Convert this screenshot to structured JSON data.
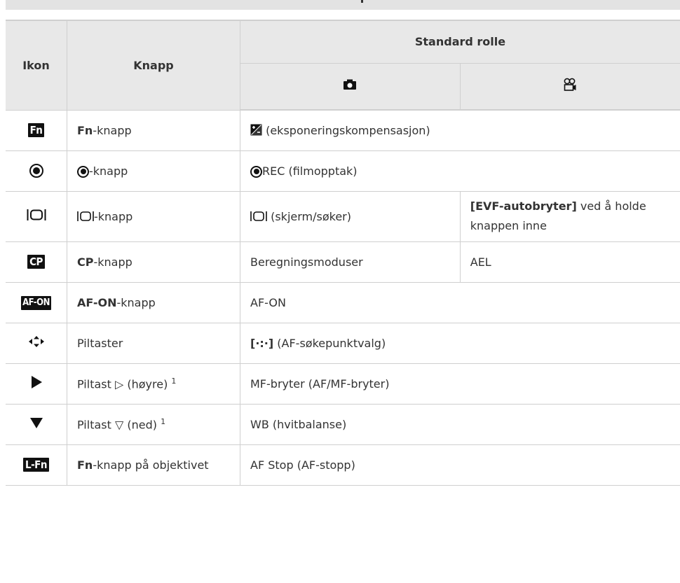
{
  "header": {
    "ikon": "Ikon",
    "knapp": "Knapp",
    "standard_rolle": "Standard rolle",
    "photo_icon": "camera-icon",
    "video_icon": "movie-camera-icon"
  },
  "rows": [
    {
      "icon": "Fn",
      "knapp_bold": "Fn",
      "knapp_rest": "-knapp",
      "photo": "(eksponeringskompensasjon)",
      "video": ""
    },
    {
      "icon": "record-icon",
      "knapp_bold": "",
      "knapp_rest": "-knapp",
      "photo": "REC (filmopptak)",
      "video": ""
    },
    {
      "icon": "monitor-viewer-icon",
      "knapp_bold": "",
      "knapp_rest": "-knapp",
      "photo": "(skjerm/søker)",
      "video_bold": "[EVF-autobryter]",
      "video": "ved å holde knappen inne"
    },
    {
      "icon": "CP",
      "knapp_bold": "CP",
      "knapp_rest": "-knapp",
      "photo": "Beregningsmoduser",
      "video": "AEL"
    },
    {
      "icon": "AF-ON",
      "knapp_bold": "AF-ON",
      "knapp_rest": "-knapp",
      "photo": "AF-ON",
      "video": ""
    },
    {
      "icon": "arrow-pad-icon",
      "knapp_rest": "Piltaster",
      "photo_bold": "[·:·]",
      "photo": "(AF-søkepunktvalg)"
    },
    {
      "icon": "play-right-icon",
      "knapp_rest": "Piltast ▷ (høyre)",
      "sup": "1",
      "photo": "MF-bryter (AF/MF-bryter)"
    },
    {
      "icon": "triangle-down-icon",
      "knapp_rest": "Piltast ▽ (ned)",
      "sup": "1",
      "photo": "WB (hvitbalanse)"
    },
    {
      "icon": "L-Fn",
      "knapp_bold": "Fn",
      "knapp_rest": "-knapp på objektivet",
      "photo": "AF Stop (AF-stopp)"
    }
  ]
}
